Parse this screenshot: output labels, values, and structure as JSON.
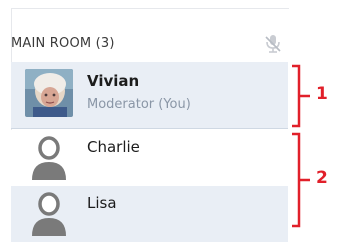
{
  "room": {
    "title": "MAIN ROOM (3)",
    "mic_icon": "microphone-icon"
  },
  "participants": [
    {
      "name": "Vivian",
      "role": "Moderator (You)",
      "avatar": "photo"
    },
    {
      "name": "Charlie",
      "avatar": "person-icon"
    },
    {
      "name": "Lisa",
      "avatar": "person-icon"
    }
  ],
  "callouts": [
    {
      "label": "1"
    },
    {
      "label": "2"
    }
  ],
  "colors": {
    "accent": "#e1202a",
    "row_highlight": "#e9eef5",
    "role_text": "#8a96a6"
  }
}
